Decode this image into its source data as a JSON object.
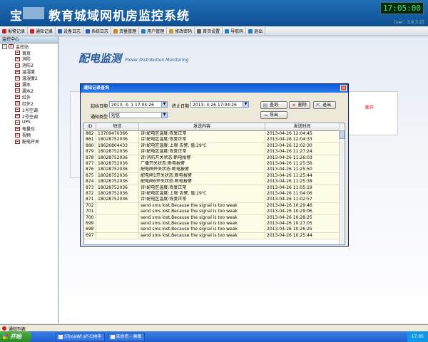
{
  "header": {
    "title": "宝　　教育城域网机房监控系统",
    "clock": "17:05:00",
    "version": "[ver：3.8.3.2]"
  },
  "menubar": {
    "items": [
      {
        "label": "报警记录",
        "icon": "alarm-icon",
        "color": "#d02020"
      },
      {
        "label": "通知记录",
        "icon": "notice-icon",
        "color": "#d02020"
      },
      {
        "label": "设备日志",
        "icon": "gear-icon",
        "color": "#2060c0"
      },
      {
        "label": "系统日志",
        "icon": "doc-icon",
        "color": "#2060c0"
      },
      {
        "label": "资量管理",
        "icon": "box-icon",
        "color": "#d08020"
      },
      {
        "label": "用户管理",
        "icon": "user-icon",
        "color": "#2080c0"
      },
      {
        "label": "修改密码",
        "icon": "key-icon",
        "color": "#c0a020"
      },
      {
        "label": "首页设置",
        "icon": "tools-icon",
        "color": "#606060"
      },
      {
        "label": "导航码",
        "icon": "nav-icon",
        "color": "#2080c0"
      },
      {
        "label": "退出",
        "icon": "exit-icon",
        "color": "#2080c0"
      }
    ]
  },
  "sidebar": {
    "title": "监控中心",
    "root": "监控站",
    "items": [
      "首页",
      "消防",
      "消防2",
      "温湿度",
      "温湿度2",
      "漏水",
      "漏水2",
      "红外",
      "红外2",
      "1号空调",
      "2号空调",
      "UPS",
      "电量仪",
      "视频",
      "配电开关"
    ]
  },
  "main": {
    "title": "配电监测",
    "subtitle": "Power Distribution Monitoring",
    "bg_text": "断开"
  },
  "dialog": {
    "title": "通知记录查询",
    "start_label": "起始日期",
    "start_value": "2013- 3- 1  17:04:26",
    "end_label": "终止日期",
    "end_value": "2013- 4-26  17:04:26",
    "type_label": "通知类型",
    "type_value": "短信",
    "buttons": {
      "query": "查询",
      "delete": "删除",
      "exit": "退出",
      "export": "导出"
    },
    "columns": [
      "ID",
      "短信",
      "发送内容",
      "发送时间"
    ],
    "rows": [
      [
        "882",
        "13709470366",
        "诗!配电区温度:恢复正常",
        "2013-04-26 12:04:45"
      ],
      [
        "881",
        "18028752036",
        "诗!配电区温度:恢复正常",
        "2013-04-26 12:04:33"
      ],
      [
        "880",
        "18626804433",
        "诗!配电区温度:上限 告警, 值:29℃",
        "2013-04-26 12:02:30"
      ],
      [
        "879",
        "18028752036",
        "诗!配电区温度:恢复正常",
        "2013-04-26 11:27:24"
      ],
      [
        "878",
        "18028752036",
        "诗!消防开关状态:断电报警",
        "2013-04-26 11:26:03"
      ],
      [
        "877",
        "18028752036",
        "广播开关状态:断电报警",
        "2013-04-26 11:25:56"
      ],
      [
        "876",
        "18028752036",
        "配电闸开关状态:断电报警",
        "2013-04-26 11:25:50"
      ],
      [
        "875",
        "18028752036",
        "配电闸1开关状态:断电报警",
        "2013-04-26 11:25:44"
      ],
      [
        "874",
        "18028752036",
        "配电闸6开关状态:断电报警",
        "2013-04-26 11:25:38"
      ],
      [
        "873",
        "18028752036",
        "诗!配电区温度:恢复正常",
        "2013-04-26 11:05:19"
      ],
      [
        "872",
        "18028752036",
        "诗!配电区温度:上限 告警, 值:29℃",
        "2013-04-26 11:04:06"
      ],
      [
        "871",
        "18028752036",
        "诗!配电区温度:恢复正常",
        "2013-04-26 11:02:57"
      ],
      [
        "702",
        "",
        "send sms lost,Because the signal is too weak",
        "2013-04-26 10:29:46"
      ],
      [
        "701",
        "",
        "send sms lost,Because the signal is too weak",
        "2013-04-26 10:29:06"
      ],
      [
        "700",
        "",
        "send sms lost,Because the signal is too weak",
        "2013-04-26 10:28:25"
      ],
      [
        "699",
        "",
        "send sms lost,Because the signal is too weak",
        "2013-04-26 10:27:05"
      ],
      [
        "698",
        "",
        "send sms lost,Because the signal is too weak",
        "2013-04-26 10:26:25"
      ],
      [
        "697",
        "",
        "send sms lost,Because the signal is too weak",
        "2013-04-26 10:25:44"
      ]
    ]
  },
  "notify_bar": {
    "label": "通知列表"
  },
  "taskbar": {
    "start": "开始",
    "tasks": [
      "STcoaWl sP-CMI中",
      "未命名 - 画图"
    ],
    "time": "17:05"
  },
  "colors": {
    "header": "#1565b0",
    "accent": "#2a5e9c",
    "row_bg": "#fefde8"
  }
}
